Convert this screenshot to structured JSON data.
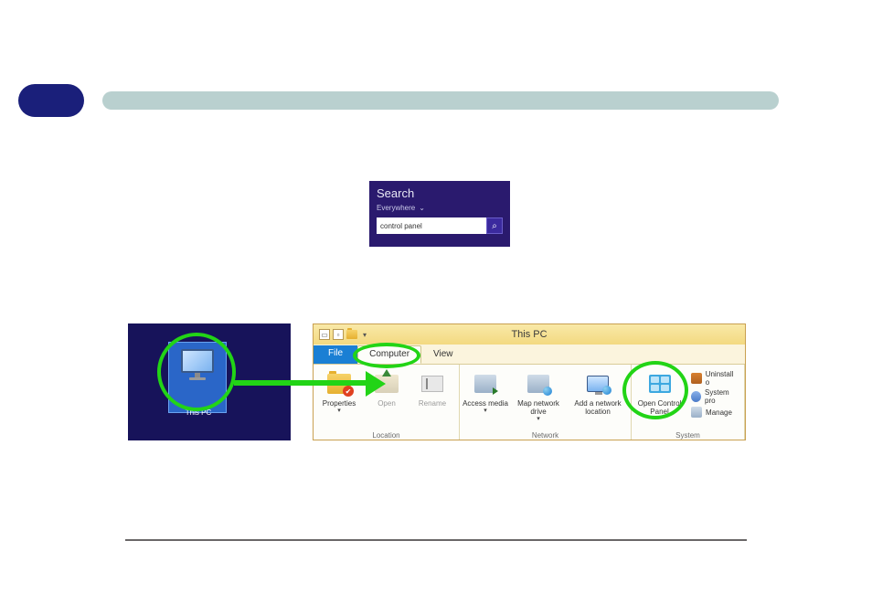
{
  "search": {
    "title": "Search",
    "scope": "Everywhere",
    "value": "control panel"
  },
  "desktop": {
    "thispc_label": "This PC"
  },
  "explorer": {
    "title": "This PC",
    "tabs": {
      "file": "File",
      "computer": "Computer",
      "view": "View"
    },
    "groups": {
      "location": {
        "label": "Location",
        "properties": "Properties",
        "open": "Open",
        "rename": "Rename"
      },
      "network": {
        "label": "Network",
        "access_media": "Access media",
        "map_drive": "Map network drive",
        "add_location": "Add a network location"
      },
      "system": {
        "label": "System",
        "open_cp": "Open Control Panel",
        "uninstall": "Uninstall o",
        "sysprop": "System pro",
        "manage": "Manage"
      }
    }
  }
}
